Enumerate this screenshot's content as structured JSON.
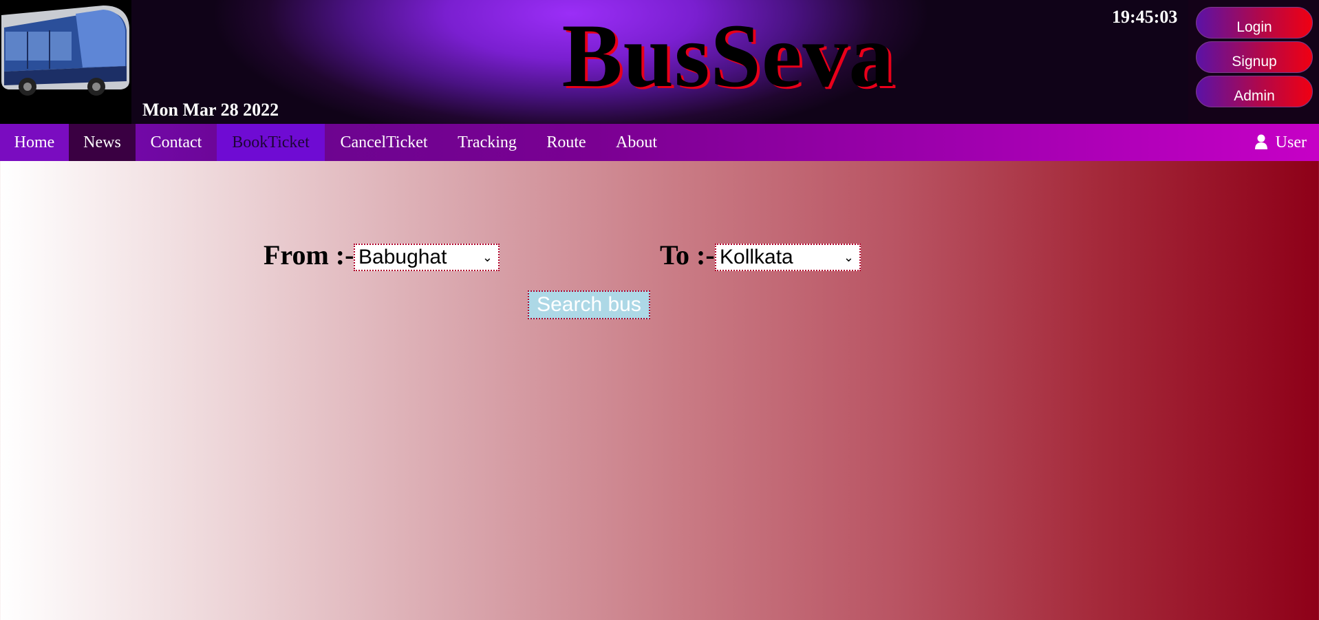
{
  "header": {
    "brand": "BusSeva",
    "date": "Mon Mar 28 2022",
    "clock": "19:45:03",
    "buttons": {
      "login": "Login",
      "signup": "Signup",
      "admin": "Admin"
    }
  },
  "nav": {
    "items": [
      "Home",
      "News",
      "Contact",
      "BookTicket",
      "CancelTicket",
      "Tracking",
      "Route",
      "About"
    ],
    "active": "BookTicket",
    "user": "User"
  },
  "form": {
    "from_label": "From :-",
    "from_value": "Babughat",
    "to_label": "To :-",
    "to_value": "Kollkata",
    "search_label": "Search bus"
  },
  "icons": {
    "user": "user-icon",
    "chevron": "chevron-down-icon",
    "logo": "bus-logo-image"
  }
}
